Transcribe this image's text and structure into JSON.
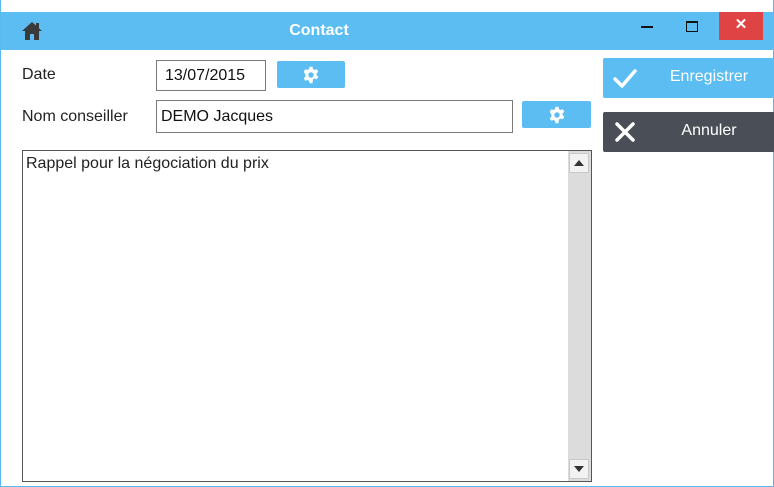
{
  "window": {
    "title": "Contact",
    "minimize_label": "—",
    "maximize_label": "□",
    "close_label": "✕"
  },
  "form": {
    "date_label": "Date",
    "date_value": "13/07/2015",
    "advisor_label": "Nom conseiller",
    "advisor_value": "DEMO Jacques",
    "notes_value": "Rappel pour la négociation du prix"
  },
  "actions": {
    "save_label": "Enregistrer",
    "cancel_label": "Annuler"
  },
  "colors": {
    "accent": "#5bbdf2",
    "dark_button": "#4a4f57",
    "close_red": "#e04343"
  },
  "icons": {
    "title_left": "home-icon",
    "field_buttons": "gear-icon",
    "save": "check-icon",
    "cancel": "close-icon"
  }
}
